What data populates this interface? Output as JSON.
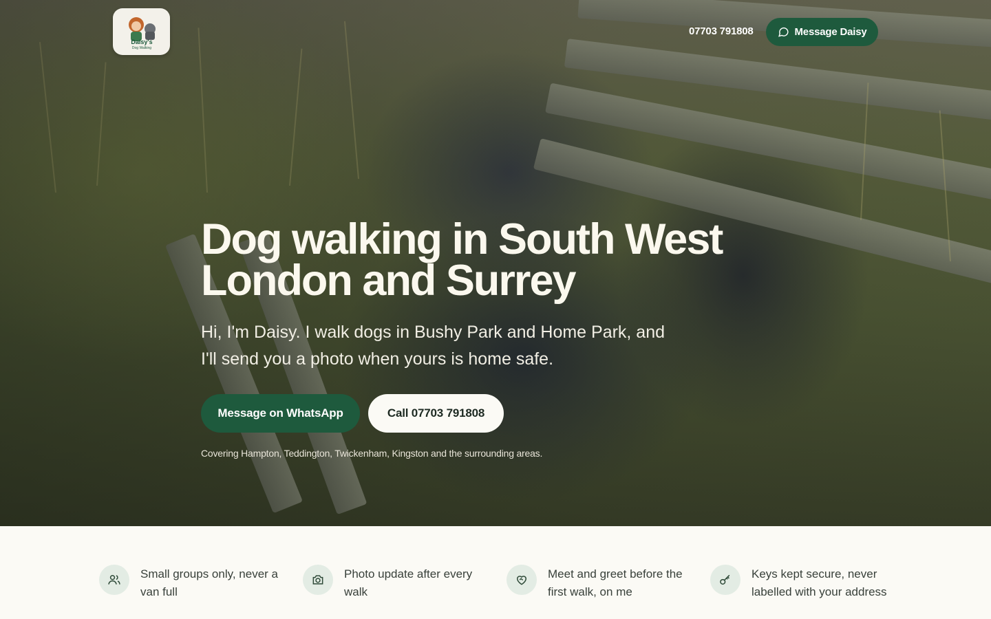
{
  "header": {
    "logo": {
      "icon": "daisys-dog-walking-logo",
      "text": "Daisy's Dog Walking"
    },
    "phone": "07703 791808",
    "cta_label": "Message Daisy",
    "cta_icon": "whatsapp-chat-icon"
  },
  "hero": {
    "title": "Dog walking in South West London and Surrey",
    "subtitle": "Hi, I'm Daisy. I walk dogs in Bushy Park and Home Park, and I'll send you a photo when yours is home safe.",
    "primary_button": "Message on WhatsApp",
    "secondary_button": "Call 07703 791808",
    "coverage": "Covering Hampton, Teddington, Twickenham, Kingston and the surrounding areas."
  },
  "features": [
    {
      "icon": "users-icon",
      "text": "Small groups only, never a van full"
    },
    {
      "icon": "camera-icon",
      "text": "Photo update after every walk"
    },
    {
      "icon": "handshake-heart-icon",
      "text": "Meet and greet before the first walk, on me"
    },
    {
      "icon": "key-icon",
      "text": "Keys kept secure, never labelled with your address"
    }
  ],
  "colors": {
    "brand_green": "#1e5a3d",
    "icon_bg": "#e3ece4",
    "page_bg": "#fbfaf5",
    "hero_text": "#fbf8ee"
  }
}
